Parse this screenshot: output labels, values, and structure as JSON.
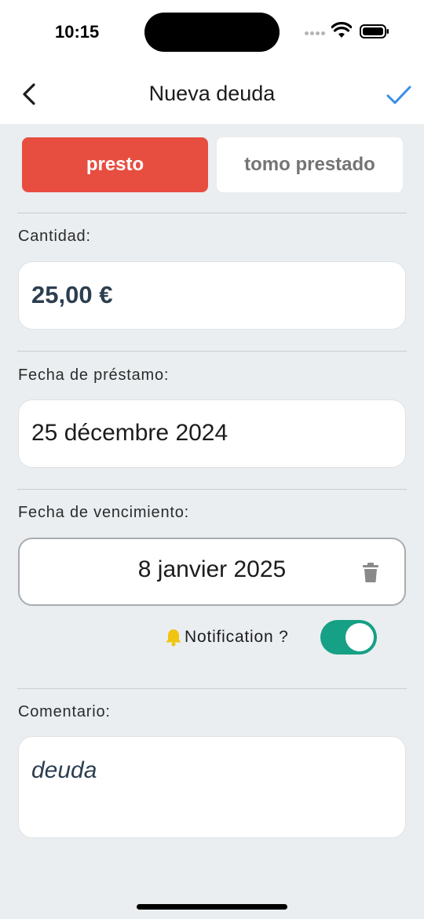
{
  "status_bar": {
    "time": "10:15"
  },
  "header": {
    "title": "Nueva deuda",
    "back_icon": "chevron-left-icon",
    "confirm_icon": "checkmark-icon"
  },
  "type_selector": {
    "lend_label": "presto",
    "borrow_label": "tomo prestado",
    "selected": "presto"
  },
  "amount": {
    "label": "Cantidad:",
    "value": "25,00 €"
  },
  "loan_date": {
    "label": "Fecha de préstamo:",
    "value": "25 décembre 2024"
  },
  "due_date": {
    "label": "Fecha de vencimiento:",
    "value": "8 janvier 2025",
    "delete_icon": "trash-icon"
  },
  "notification": {
    "icon": "bell-icon",
    "label": "Notification ?",
    "enabled": true
  },
  "comment": {
    "label": "Comentario:",
    "value": "deuda"
  },
  "colors": {
    "accent_red": "#e84e40",
    "toggle_green": "#16a085",
    "check_blue": "#3a8ee6",
    "bell_yellow": "#f1c40f",
    "background": "#eaeef0"
  }
}
